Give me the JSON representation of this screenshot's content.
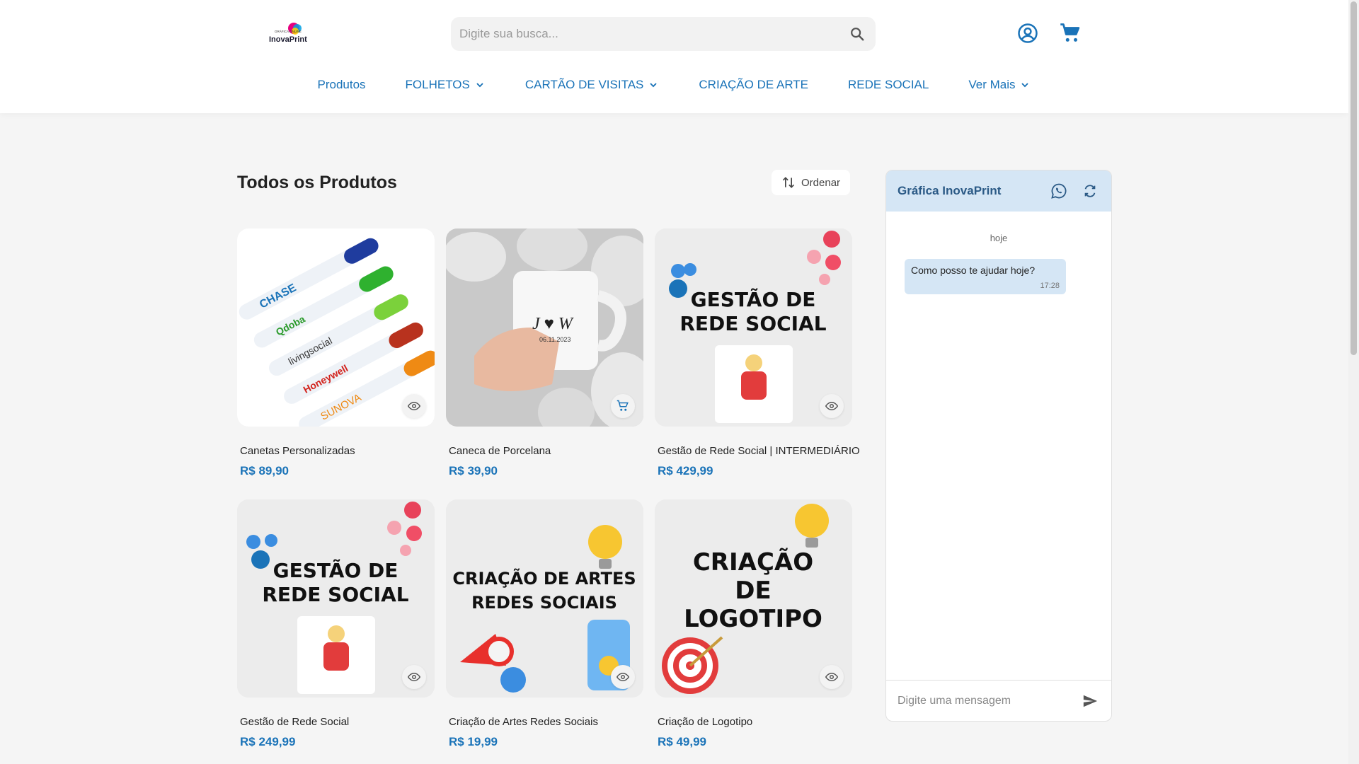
{
  "brand": {
    "logo_small_text": "GRÁFICA ONLINE",
    "logo_text": "InovaPrint",
    "accent": "#1a73b8"
  },
  "search": {
    "placeholder": "Digite sua busca..."
  },
  "header_icons": {
    "user": "user-circle-icon",
    "cart": "cart-icon"
  },
  "nav": [
    {
      "label": "Produtos",
      "dropdown": false
    },
    {
      "label": "FOLHETOS",
      "dropdown": true
    },
    {
      "label": "CARTÃO DE VISITAS",
      "dropdown": true
    },
    {
      "label": "CRIAÇÃO DE ARTE",
      "dropdown": false
    },
    {
      "label": "REDE SOCIAL",
      "dropdown": false
    },
    {
      "label": "Ver Mais",
      "dropdown": true
    }
  ],
  "main": {
    "title": "Todos os Produtos",
    "sort_label": "Ordenar"
  },
  "products": [
    {
      "name": "Canetas Personalizadas",
      "price": "R$ 89,90",
      "action": "eye-icon",
      "art": {
        "brands": [
          "CHASE",
          "Qdoba",
          "livingsocial",
          "Honeywell",
          "SUNOVA"
        ]
      }
    },
    {
      "name": "Caneca de Porcelana",
      "price": "R$ 39,90",
      "action": "add-to-cart-icon",
      "art": {
        "mug_text": "J ♥ W",
        "mug_date": "06.11.2023"
      }
    },
    {
      "name": "Gestão de Rede Social | INTERMEDIÁRIO",
      "price": "R$ 429,99",
      "action": "eye-icon",
      "art": {
        "line1": "GESTÃO DE",
        "line2": "REDE SOCIAL"
      }
    },
    {
      "name": "Gestão de Rede Social",
      "price": "R$ 249,99",
      "action": "eye-icon",
      "art": {
        "line1": "GESTÃO DE",
        "line2": "REDE SOCIAL"
      }
    },
    {
      "name": "Criação de Artes Redes Sociais",
      "price": "R$ 19,99",
      "action": "eye-icon",
      "art": {
        "line1": "CRIAÇÃO DE ARTES",
        "line2": "REDES SOCIAIS"
      }
    },
    {
      "name": "Criação de Logotipo",
      "price": "R$ 49,99",
      "action": "eye-icon",
      "art": {
        "line1": "CRIAÇÃO",
        "line2": "DE",
        "line3": "LOGOTIPO"
      }
    }
  ],
  "chat": {
    "title": "Gráfica InovaPrint",
    "date_label": "hoje",
    "messages": [
      {
        "text": "Como posso te ajudar hoje?",
        "time": "17:28"
      }
    ],
    "input_placeholder": "Digite uma mensagem"
  }
}
